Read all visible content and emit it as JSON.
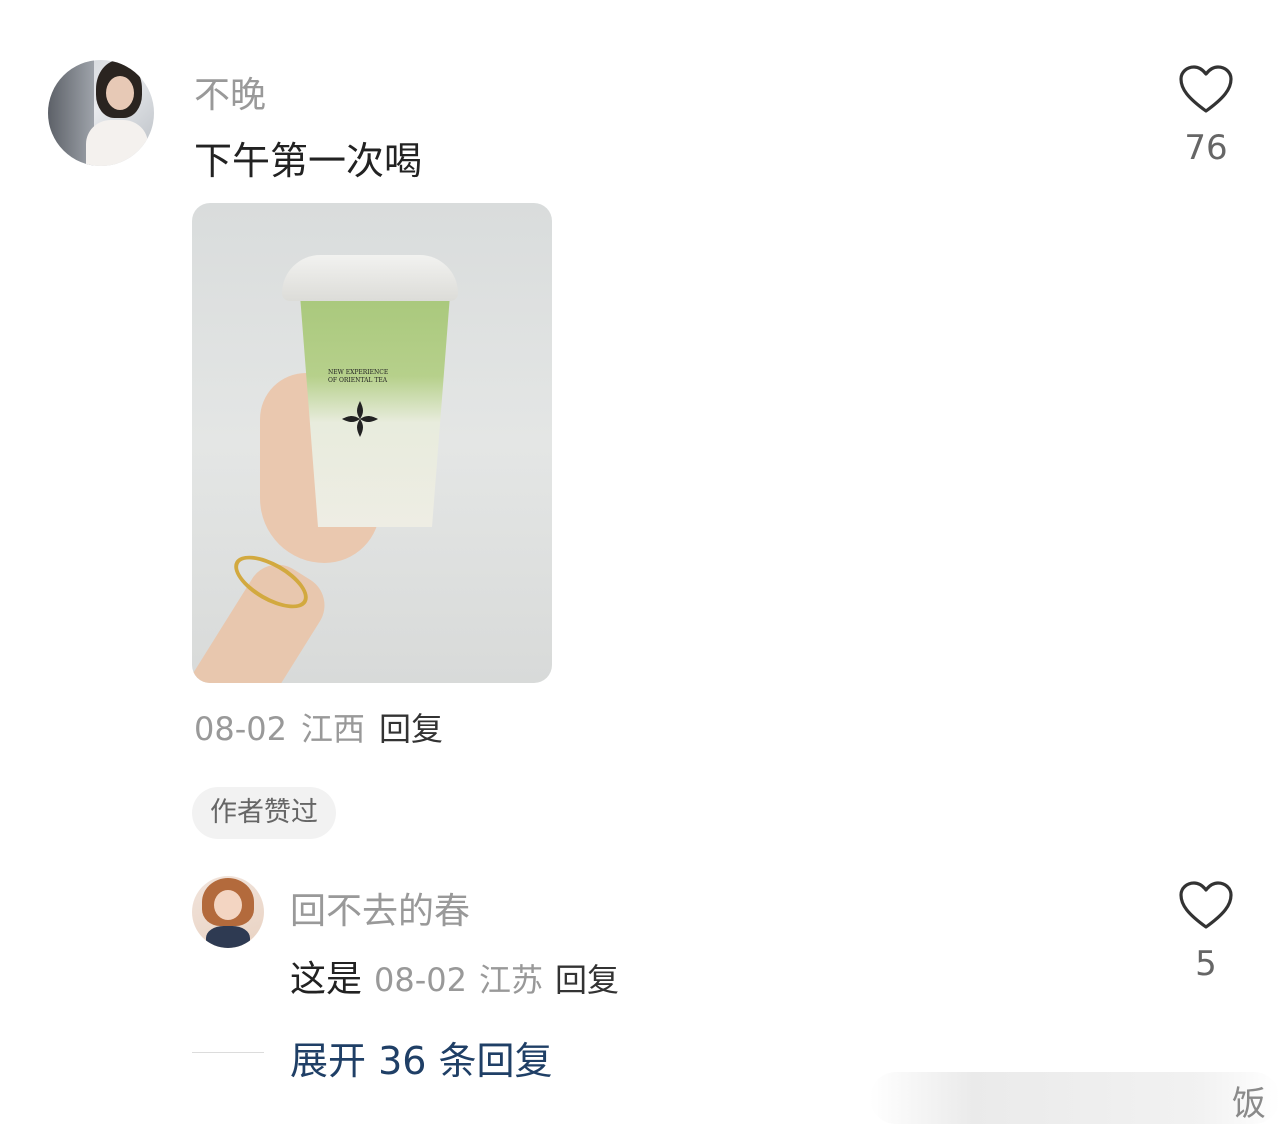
{
  "comment": {
    "username": "不晚",
    "text": "下午第一次喝",
    "date": "08-02",
    "location": "江西",
    "reply_label": "回复",
    "likes": "76",
    "author_badge": "作者赞过",
    "photo": {
      "cup_text": "NEW EXPERIENCE OF ORIENTAL TEA"
    }
  },
  "reply": {
    "username": "回不去的春",
    "text": "这是",
    "date": "08-02",
    "location": "江苏",
    "reply_label": "回复",
    "likes": "5"
  },
  "expand_label": "展开 36 条回复",
  "watermark_text": "饭",
  "colors": {
    "link": "#1f3f66",
    "meta": "#999999",
    "text": "#222222"
  }
}
